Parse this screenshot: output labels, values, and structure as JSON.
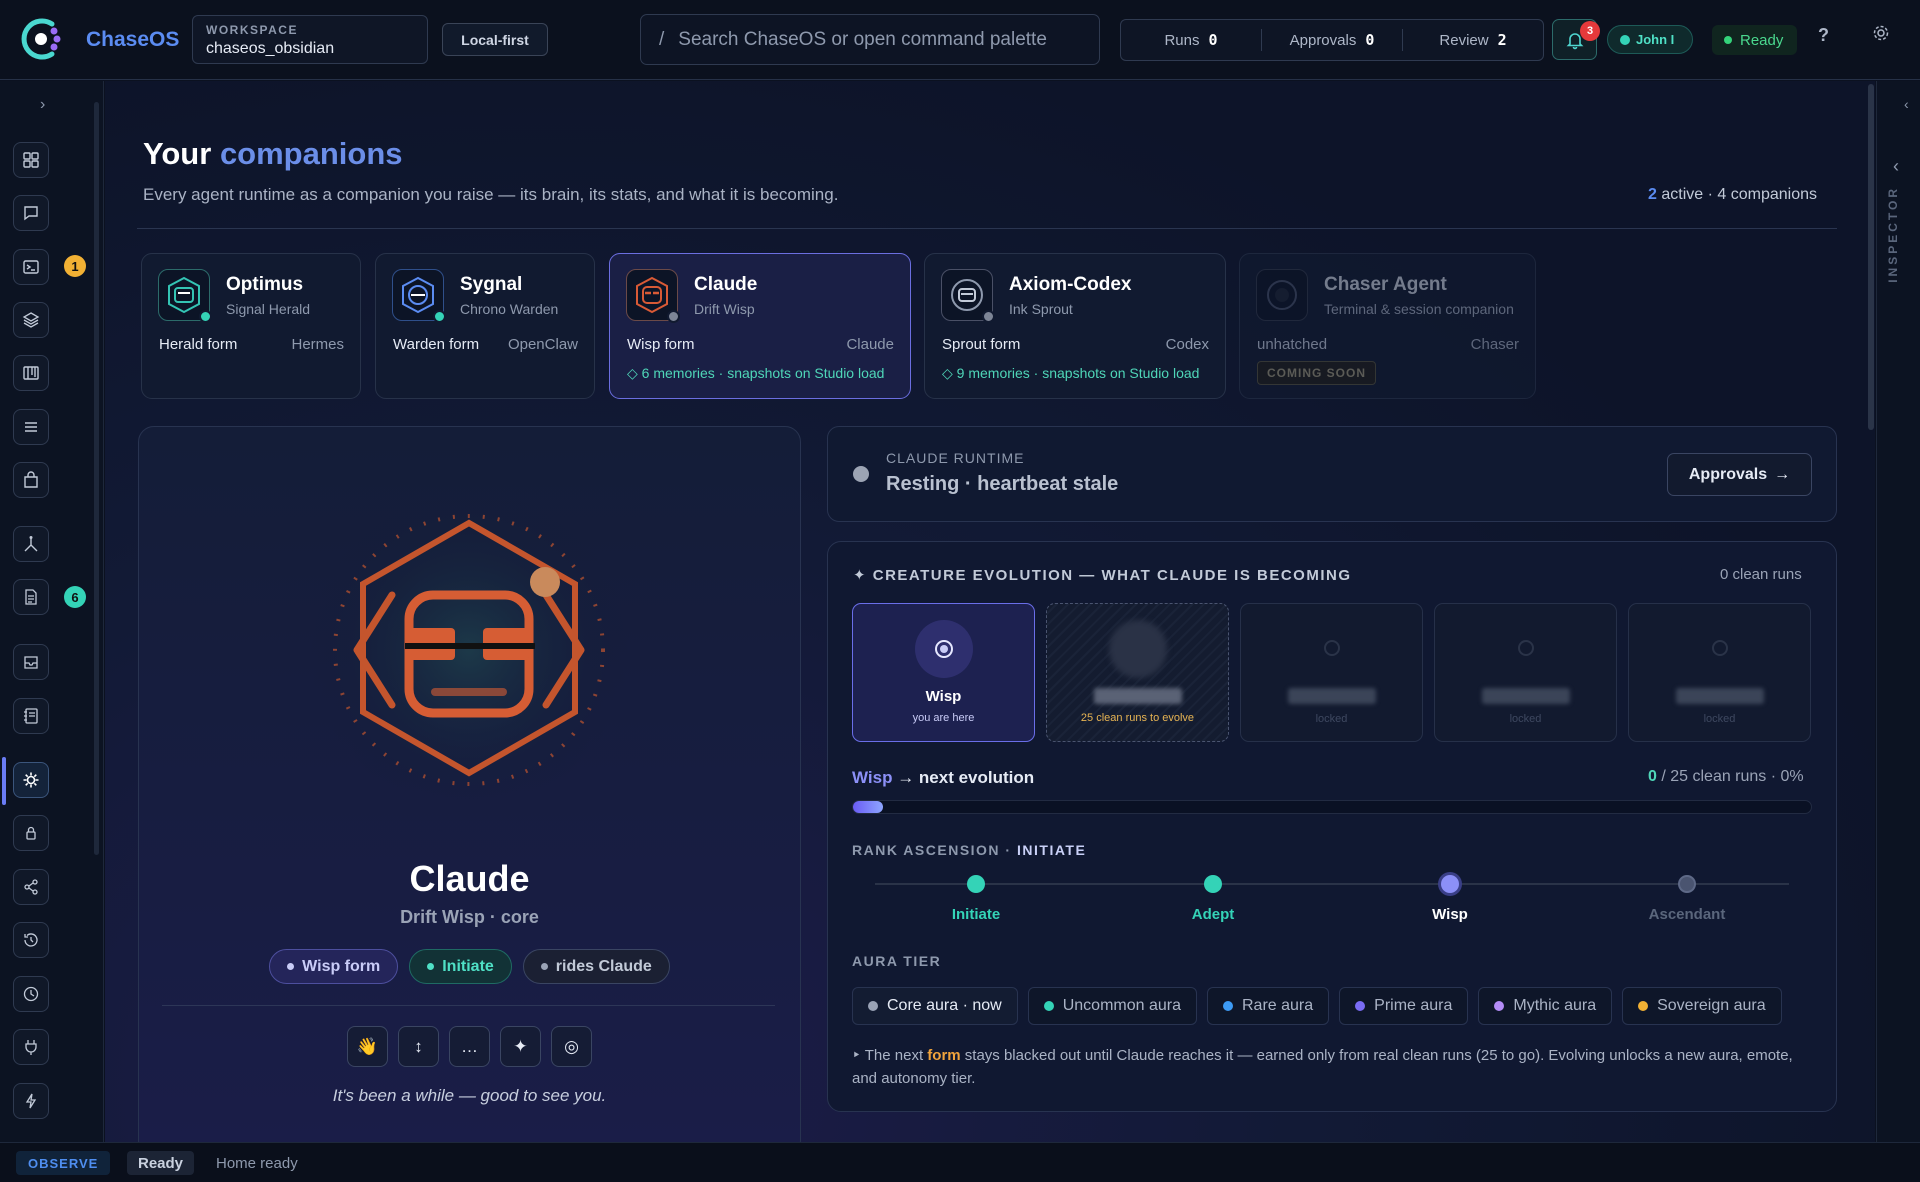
{
  "app": {
    "brand": "ChaseOS"
  },
  "workspace": {
    "label": "WORKSPACE",
    "name": "chaseos_obsidian",
    "mode": "Local-first"
  },
  "search": {
    "slash": "/",
    "placeholder": "Search ChaseOS or open command palette"
  },
  "counters": [
    {
      "label": "Runs",
      "value": "0"
    },
    {
      "label": "Approvals",
      "value": "0"
    },
    {
      "label": "Review",
      "value": "2"
    }
  ],
  "notifications": {
    "count": "3"
  },
  "user": {
    "name": "John I"
  },
  "system": {
    "status": "Ready",
    "help": "?"
  },
  "sidebar": {
    "expand": "›",
    "badges": [
      {
        "value": "1",
        "color": "#f2b134"
      },
      {
        "value": "6",
        "color": "#34d3b7"
      }
    ]
  },
  "page": {
    "title_prefix": "Your ",
    "title_highlight": "companions",
    "subtitle": "Every agent runtime as a companion you raise — its brain, its stats, and what it is becoming.",
    "active_count": "2",
    "active_text": " active · 4 companions"
  },
  "companions": [
    {
      "name": "Optimus",
      "role": "Signal Herald",
      "form": "Herald form",
      "runtime": "Hermes"
    },
    {
      "name": "Sygnal",
      "role": "Chrono Warden",
      "form": "Warden form",
      "runtime": "OpenClaw"
    },
    {
      "name": "Claude",
      "role": "Drift Wisp",
      "form": "Wisp form",
      "runtime": "Claude",
      "memories": "◇ 6 memories · snapshots on Studio load"
    },
    {
      "name": "Axiom-Codex",
      "role": "Ink Sprout",
      "form": "Sprout form",
      "runtime": "Codex",
      "memories": "◇ 9 memories · snapshots on Studio load"
    },
    {
      "name": "Chaser Agent",
      "role": "Terminal & session companion",
      "form": "unhatched",
      "runtime": "Chaser",
      "badge": "COMING SOON"
    }
  ],
  "hero": {
    "name": "Claude",
    "subtitle": "Drift Wisp · core",
    "chips": [
      "Wisp form",
      "Initiate",
      "rides Claude"
    ],
    "emotes": [
      "👋",
      "↕",
      "…",
      "✦",
      "◎"
    ],
    "greeting": "It's been a while — good to see you."
  },
  "runtime": {
    "label": "CLAUDE RUNTIME",
    "state": "Resting · heartbeat stale",
    "button": "Approvals",
    "button_arrow": "→"
  },
  "evolution": {
    "heading": "✦  CREATURE EVOLUTION — WHAT CLAUDE IS BECOMING",
    "clean_runs": "0 clean runs",
    "stages": [
      {
        "name": "Wisp",
        "caption": "you are here"
      },
      {
        "caption": "25 clean runs to evolve"
      },
      {
        "caption": "locked"
      },
      {
        "caption": "locked"
      },
      {
        "caption": "locked"
      }
    ],
    "next_form": "Wisp",
    "next_label": " → next evolution",
    "progress_value": "0",
    "progress_text": " / 25 clean runs · 0%",
    "progress_fraction": 0.0
  },
  "rank": {
    "heading": "RANK ASCENSION · ",
    "current": "INITIATE",
    "nodes": [
      {
        "label": "Initiate",
        "color": "#34d3b7"
      },
      {
        "label": "Adept",
        "color": "#34d3b7"
      },
      {
        "label": "Wisp",
        "color": "#8c90f7"
      },
      {
        "label": "Ascendant",
        "color": "#5a667c"
      }
    ]
  },
  "aura": {
    "heading": "AURA TIER",
    "tiers": [
      {
        "label": "Core aura · now",
        "color": "#9aa3b6"
      },
      {
        "label": "Uncommon aura",
        "color": "#34d3b7"
      },
      {
        "label": "Rare aura",
        "color": "#3d9bf5"
      },
      {
        "label": "Prime aura",
        "color": "#7a6cf5"
      },
      {
        "label": "Mythic aura",
        "color": "#b48cf7"
      },
      {
        "label": "Sovereign aura",
        "color": "#f2b134"
      }
    ],
    "note_pre": "‣ The next ",
    "note_form": "form",
    "note_post": " stays blacked out until Claude reaches it — earned only from real clean runs (25 to go). Evolving unlocks a new aura, emote, and autonomy tier."
  },
  "inspector": {
    "label": "INSPECTOR"
  },
  "statusbar": {
    "mode": "OBSERVE",
    "state": "Ready",
    "message": "Home ready"
  }
}
